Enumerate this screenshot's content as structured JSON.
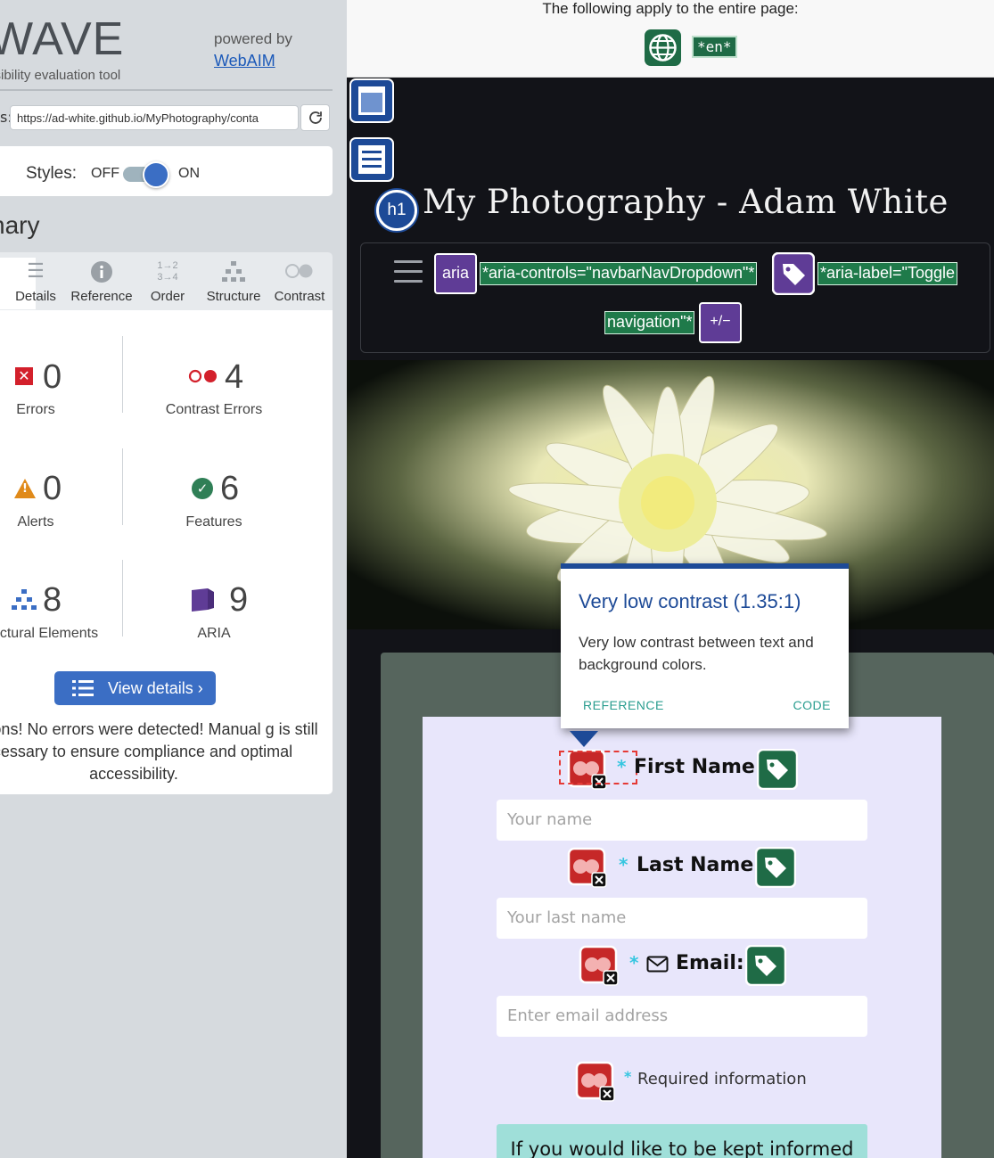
{
  "wave": {
    "logo": "WAVE",
    "tagline": "ssibility evaluation tool",
    "powered_by": "powered by",
    "webaim_link": "WebAIM",
    "address_label": "s:",
    "address_value": "https://ad-white.github.io/MyPhotography/conta",
    "styles_label": "Styles:",
    "styles_off": "OFF",
    "styles_on": "ON",
    "summary_heading": "nary",
    "tabs": [
      {
        "label": "Details",
        "icon": "list-icon"
      },
      {
        "label": "Reference",
        "icon": "info-icon"
      },
      {
        "label": "Order",
        "icon": "order-icon"
      },
      {
        "label": "Structure",
        "icon": "structure-icon"
      },
      {
        "label": "Contrast",
        "icon": "contrast-icon"
      }
    ],
    "stats": {
      "errors": {
        "count": "0",
        "label": "Errors"
      },
      "contrast_errors": {
        "count": "4",
        "label": "Contrast Errors"
      },
      "alerts": {
        "count": "0",
        "label": "Alerts"
      },
      "features": {
        "count": "6",
        "label": "Features"
      },
      "structural": {
        "count": "8",
        "label": "ctural Elements"
      },
      "aria": {
        "count": "9",
        "label": "ARIA"
      }
    },
    "view_details": "View details ›",
    "congrats": "atulations! No errors were detected! Manual g is still necessary to ensure compliance and optimal accessibility."
  },
  "page": {
    "top_note": "The following apply to the entire page:",
    "lang_tag": "*en*",
    "site_title": "My Photography - Adam White",
    "h1_badge": "h1",
    "nav": {
      "aria_badge": "aria",
      "aria_controls": "*aria-controls=\"navbarNavDropdown\"*",
      "aria_label_1": "*aria-label=\"Toggle",
      "aria_label_2": "navigation\"*",
      "expand_badge": "+/−"
    },
    "popup": {
      "title": "Very low contrast (1.35:1)",
      "body": "Very low contrast between text and background colors.",
      "reference": "REFERENCE",
      "code": "CODE"
    },
    "form": {
      "first_name_label": "First Name:",
      "first_name_placeholder": "Your name",
      "last_name_label": "Last Name:",
      "last_name_placeholder": "Your last name",
      "email_label": "Email:",
      "email_placeholder": "Enter email address",
      "required_star": "*",
      "required_info": "Required information",
      "keep_informed": "If you would like to be kept informed"
    }
  },
  "colors": {
    "wave_blue": "#3b6ec4",
    "error_red": "#d3202b",
    "feature_green": "#1f6b46",
    "aria_purple": "#5f3c96",
    "h1_blue": "#1d4a97"
  }
}
